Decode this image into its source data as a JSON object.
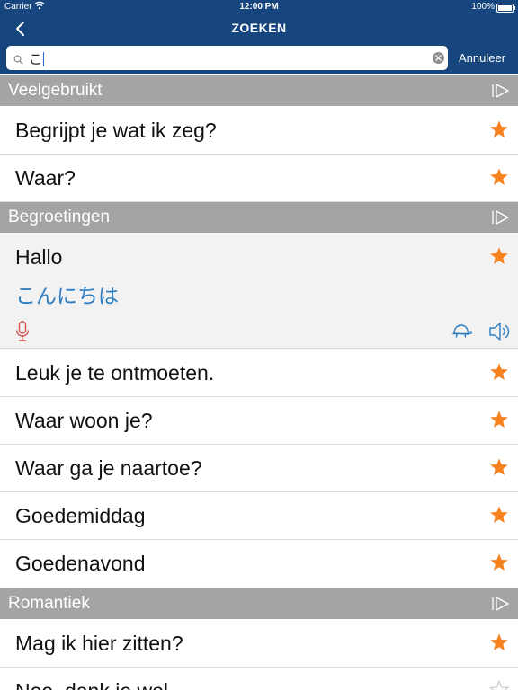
{
  "status_bar": {
    "carrier": "Carrier",
    "time": "12:00 PM",
    "battery": "100%"
  },
  "nav": {
    "title": "ZOEKEN"
  },
  "search": {
    "query": "こ",
    "cancel_label": "Annuleer"
  },
  "sections": [
    {
      "title": "Veelgebruikt",
      "items": [
        {
          "phrase": "Begrijpt je wat ik zeg?",
          "favorite": true
        },
        {
          "phrase": "Waar?",
          "favorite": true
        }
      ]
    },
    {
      "title": "Begroetingen",
      "items": [
        {
          "phrase": "Hallo",
          "translation": "こんにちは",
          "favorite": true,
          "expanded": true
        },
        {
          "phrase": "Leuk je te ontmoeten.",
          "favorite": true
        },
        {
          "phrase": "Waar woon je?",
          "favorite": true
        },
        {
          "phrase": "Waar ga je naartoe?",
          "favorite": true
        },
        {
          "phrase": "Goedemiddag",
          "favorite": true
        },
        {
          "phrase": "Goedenavond",
          "favorite": true
        }
      ]
    },
    {
      "title": "Romantiek",
      "items": [
        {
          "phrase": "Mag ik hier zitten?",
          "favorite": true
        },
        {
          "phrase": "Nee, dank je wel.",
          "favorite": false
        }
      ]
    }
  ],
  "colors": {
    "nav_background": "#17467e",
    "section_background": "#a4a4a4",
    "star_active": "#f5821f",
    "translation": "#2f7ec1",
    "icon_blue": "#2f7ec1",
    "mic_red": "#d9534f"
  }
}
